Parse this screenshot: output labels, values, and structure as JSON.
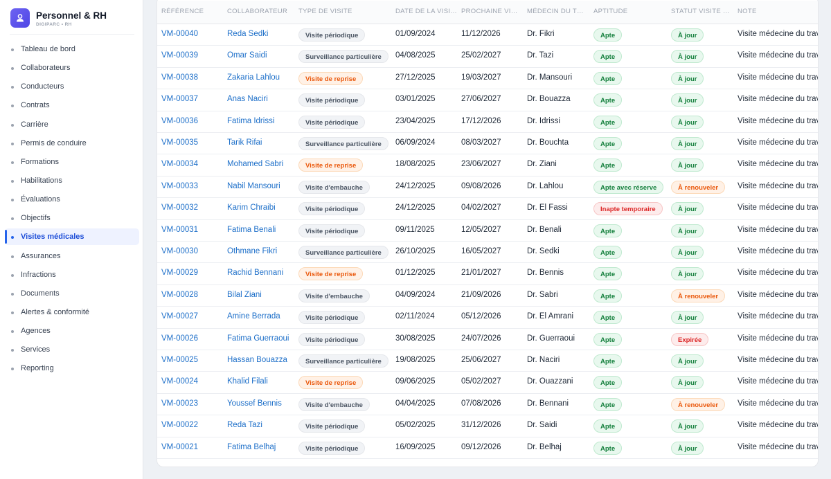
{
  "app": {
    "title": "Personnel & RH",
    "subtitle": "DIGIPARC • RH"
  },
  "sidebar": {
    "items": [
      {
        "label": "Tableau de bord",
        "active": false
      },
      {
        "label": "Collaborateurs",
        "active": false
      },
      {
        "label": "Conducteurs",
        "active": false
      },
      {
        "label": "Contrats",
        "active": false
      },
      {
        "label": "Carrière",
        "active": false
      },
      {
        "label": "Permis de conduire",
        "active": false
      },
      {
        "label": "Formations",
        "active": false
      },
      {
        "label": "Habilitations",
        "active": false
      },
      {
        "label": "Évaluations",
        "active": false
      },
      {
        "label": "Objectifs",
        "active": false
      },
      {
        "label": "Visites médicales",
        "active": true
      },
      {
        "label": "Assurances",
        "active": false
      },
      {
        "label": "Infractions",
        "active": false
      },
      {
        "label": "Documents",
        "active": false
      },
      {
        "label": "Alertes & conformité",
        "active": false
      },
      {
        "label": "Agences",
        "active": false
      },
      {
        "label": "Services",
        "active": false
      },
      {
        "label": "Reporting",
        "active": false
      }
    ]
  },
  "table": {
    "columns": [
      "Référence",
      "Collaborateur",
      "Type de visite",
      "Date de la visi…",
      "Prochaine vi…",
      "Médecin du t…",
      "Aptitude",
      "Statut visite …",
      "Note"
    ],
    "rows": [
      {
        "ref": "VM-00040",
        "collab": "Reda Sedki",
        "type": "Visite périodique",
        "type_color": "gray",
        "date": "01/09/2024",
        "next": "11/12/2026",
        "doctor": "Dr. Fikri",
        "aptitude": "Apte",
        "aptitude_color": "green",
        "status": "À jour",
        "status_color": "green",
        "note": "Visite médecine du trav"
      },
      {
        "ref": "VM-00039",
        "collab": "Omar Saidi",
        "type": "Surveillance particulière",
        "type_color": "gray",
        "date": "04/08/2025",
        "next": "25/02/2027",
        "doctor": "Dr. Tazi",
        "aptitude": "Apte",
        "aptitude_color": "green",
        "status": "À jour",
        "status_color": "green",
        "note": "Visite médecine du trav"
      },
      {
        "ref": "VM-00038",
        "collab": "Zakaria Lahlou",
        "type": "Visite de reprise",
        "type_color": "orange",
        "date": "27/12/2025",
        "next": "19/03/2027",
        "doctor": "Dr. Mansouri",
        "aptitude": "Apte",
        "aptitude_color": "green",
        "status": "À jour",
        "status_color": "green",
        "note": "Visite médecine du trav"
      },
      {
        "ref": "VM-00037",
        "collab": "Anas Naciri",
        "type": "Visite périodique",
        "type_color": "gray",
        "date": "03/01/2025",
        "next": "27/06/2027",
        "doctor": "Dr. Bouazza",
        "aptitude": "Apte",
        "aptitude_color": "green",
        "status": "À jour",
        "status_color": "green",
        "note": "Visite médecine du trav"
      },
      {
        "ref": "VM-00036",
        "collab": "Fatima Idrissi",
        "type": "Visite périodique",
        "type_color": "gray",
        "date": "23/04/2025",
        "next": "17/12/2026",
        "doctor": "Dr. Idrissi",
        "aptitude": "Apte",
        "aptitude_color": "green",
        "status": "À jour",
        "status_color": "green",
        "note": "Visite médecine du trav"
      },
      {
        "ref": "VM-00035",
        "collab": "Tarik Rifai",
        "type": "Surveillance particulière",
        "type_color": "gray",
        "date": "06/09/2024",
        "next": "08/03/2027",
        "doctor": "Dr. Bouchta",
        "aptitude": "Apte",
        "aptitude_color": "green",
        "status": "À jour",
        "status_color": "green",
        "note": "Visite médecine du trav"
      },
      {
        "ref": "VM-00034",
        "collab": "Mohamed Sabri",
        "type": "Visite de reprise",
        "type_color": "orange",
        "date": "18/08/2025",
        "next": "23/06/2027",
        "doctor": "Dr. Ziani",
        "aptitude": "Apte",
        "aptitude_color": "green",
        "status": "À jour",
        "status_color": "green",
        "note": "Visite médecine du trav"
      },
      {
        "ref": "VM-00033",
        "collab": "Nabil Mansouri",
        "type": "Visite d'embauche",
        "type_color": "gray",
        "date": "24/12/2025",
        "next": "09/08/2026",
        "doctor": "Dr. Lahlou",
        "aptitude": "Apte avec réserve",
        "aptitude_color": "green",
        "status": "À renouveler",
        "status_color": "orange",
        "note": "Visite médecine du trav"
      },
      {
        "ref": "VM-00032",
        "collab": "Karim Chraibi",
        "type": "Visite périodique",
        "type_color": "gray",
        "date": "24/12/2025",
        "next": "04/02/2027",
        "doctor": "Dr. El Fassi",
        "aptitude": "Inapte temporaire",
        "aptitude_color": "red",
        "status": "À jour",
        "status_color": "green",
        "note": "Visite médecine du trav"
      },
      {
        "ref": "VM-00031",
        "collab": "Fatima Benali",
        "type": "Visite périodique",
        "type_color": "gray",
        "date": "09/11/2025",
        "next": "12/05/2027",
        "doctor": "Dr. Benali",
        "aptitude": "Apte",
        "aptitude_color": "green",
        "status": "À jour",
        "status_color": "green",
        "note": "Visite médecine du trav"
      },
      {
        "ref": "VM-00030",
        "collab": "Othmane Fikri",
        "type": "Surveillance particulière",
        "type_color": "gray",
        "date": "26/10/2025",
        "next": "16/05/2027",
        "doctor": "Dr. Sedki",
        "aptitude": "Apte",
        "aptitude_color": "green",
        "status": "À jour",
        "status_color": "green",
        "note": "Visite médecine du trav"
      },
      {
        "ref": "VM-00029",
        "collab": "Rachid Bennani",
        "type": "Visite de reprise",
        "type_color": "orange",
        "date": "01/12/2025",
        "next": "21/01/2027",
        "doctor": "Dr. Bennis",
        "aptitude": "Apte",
        "aptitude_color": "green",
        "status": "À jour",
        "status_color": "green",
        "note": "Visite médecine du trav"
      },
      {
        "ref": "VM-00028",
        "collab": "Bilal Ziani",
        "type": "Visite d'embauche",
        "type_color": "gray",
        "date": "04/09/2024",
        "next": "21/09/2026",
        "doctor": "Dr. Sabri",
        "aptitude": "Apte",
        "aptitude_color": "green",
        "status": "À renouveler",
        "status_color": "orange",
        "note": "Visite médecine du trav"
      },
      {
        "ref": "VM-00027",
        "collab": "Amine Berrada",
        "type": "Visite périodique",
        "type_color": "gray",
        "date": "02/11/2024",
        "next": "05/12/2026",
        "doctor": "Dr. El Amrani",
        "aptitude": "Apte",
        "aptitude_color": "green",
        "status": "À jour",
        "status_color": "green",
        "note": "Visite médecine du trav"
      },
      {
        "ref": "VM-00026",
        "collab": "Fatima Guerraoui",
        "type": "Visite périodique",
        "type_color": "gray",
        "date": "30/08/2025",
        "next": "24/07/2026",
        "doctor": "Dr. Guerraoui",
        "aptitude": "Apte",
        "aptitude_color": "green",
        "status": "Expirée",
        "status_color": "red",
        "note": "Visite médecine du trav"
      },
      {
        "ref": "VM-00025",
        "collab": "Hassan Bouazza",
        "type": "Surveillance particulière",
        "type_color": "gray",
        "date": "19/08/2025",
        "next": "25/06/2027",
        "doctor": "Dr. Naciri",
        "aptitude": "Apte",
        "aptitude_color": "green",
        "status": "À jour",
        "status_color": "green",
        "note": "Visite médecine du trav"
      },
      {
        "ref": "VM-00024",
        "collab": "Khalid Filali",
        "type": "Visite de reprise",
        "type_color": "orange",
        "date": "09/06/2025",
        "next": "05/02/2027",
        "doctor": "Dr. Ouazzani",
        "aptitude": "Apte",
        "aptitude_color": "green",
        "status": "À jour",
        "status_color": "green",
        "note": "Visite médecine du trav"
      },
      {
        "ref": "VM-00023",
        "collab": "Youssef Bennis",
        "type": "Visite d'embauche",
        "type_color": "gray",
        "date": "04/04/2025",
        "next": "07/08/2026",
        "doctor": "Dr. Bennani",
        "aptitude": "Apte",
        "aptitude_color": "green",
        "status": "À renouveler",
        "status_color": "orange",
        "note": "Visite médecine du trav"
      },
      {
        "ref": "VM-00022",
        "collab": "Reda Tazi",
        "type": "Visite périodique",
        "type_color": "gray",
        "date": "05/02/2025",
        "next": "31/12/2026",
        "doctor": "Dr. Saidi",
        "aptitude": "Apte",
        "aptitude_color": "green",
        "status": "À jour",
        "status_color": "green",
        "note": "Visite médecine du trav"
      },
      {
        "ref": "VM-00021",
        "collab": "Fatima Belhaj",
        "type": "Visite périodique",
        "type_color": "gray",
        "date": "16/09/2025",
        "next": "09/12/2026",
        "doctor": "Dr. Belhaj",
        "aptitude": "Apte",
        "aptitude_color": "green",
        "status": "À jour",
        "status_color": "green",
        "note": "Visite médecine du trav"
      }
    ]
  }
}
